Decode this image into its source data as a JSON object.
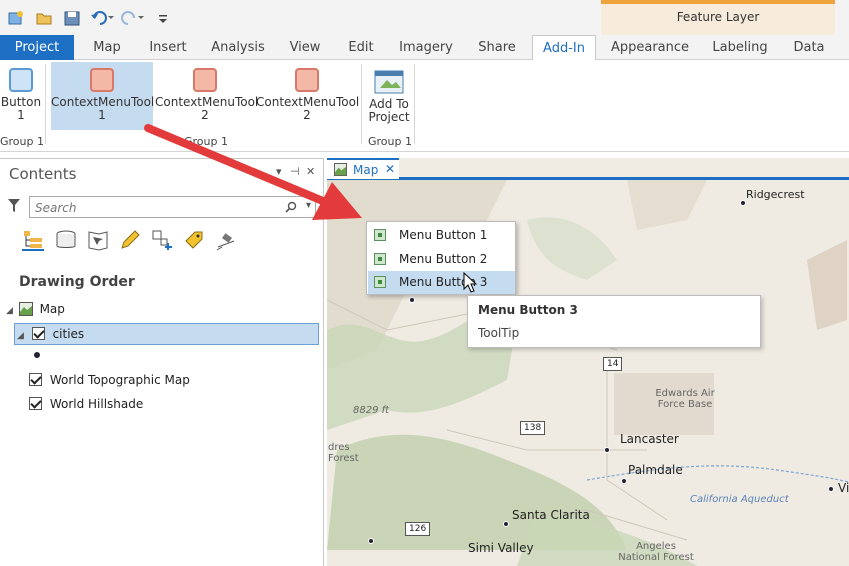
{
  "colors": {
    "accent": "#1d6fc4",
    "context_band": "#f0a33a",
    "selection": "#c5dbef"
  },
  "qat": {
    "icons": [
      "new-project-icon",
      "open-project-icon",
      "save-project-icon",
      "undo-icon",
      "redo-icon",
      "customize-icon"
    ]
  },
  "context_tab": {
    "label": "Feature Layer"
  },
  "tabs": [
    {
      "label": "Project"
    },
    {
      "label": "Map"
    },
    {
      "label": "Insert"
    },
    {
      "label": "Analysis"
    },
    {
      "label": "View"
    },
    {
      "label": "Edit"
    },
    {
      "label": "Imagery"
    },
    {
      "label": "Share"
    },
    {
      "label": "Add-In"
    },
    {
      "label": "Appearance"
    },
    {
      "label": "Labeling"
    },
    {
      "label": "Data"
    }
  ],
  "active_tab": "Add-In",
  "ribbon": {
    "buttons": [
      {
        "line1": "Button",
        "line2": "1"
      },
      {
        "line1": "ContextMenuTool",
        "line2": "1"
      },
      {
        "line1": "ContextMenuTool",
        "line2": "2"
      },
      {
        "line1": "ContextMenuTool",
        "line2": "2"
      },
      {
        "line1": "Add To",
        "line2": "Project"
      }
    ],
    "groups": [
      "Group 1",
      "Group 1",
      "Group 1"
    ]
  },
  "contents": {
    "title": "Contents",
    "search_placeholder": "Search",
    "heading": "Drawing Order",
    "tree": {
      "map": "Map",
      "layer": "cities",
      "basemap1": "World Topographic Map",
      "basemap2": "World Hillshade"
    },
    "tool_icons": [
      "list-by-drawing-order-icon",
      "list-by-source-icon",
      "list-by-selection-icon",
      "list-by-editing-icon",
      "list-by-snapping-icon",
      "list-by-labeling-icon",
      "list-by-perspective-icon"
    ]
  },
  "map": {
    "tab_label": "Map",
    "cities": [
      "Ridgecrest",
      "Lancaster",
      "Palmdale",
      "Santa Clarita",
      "Simi Valley",
      "Vi"
    ],
    "labels": {
      "edwards": "Edwards Air Force Base",
      "angeles": "Angeles National Forest",
      "aqueduct": "California Aqueduct",
      "elevation": "8829 ft",
      "forest_left": "dres Forest"
    },
    "shields": [
      "14",
      "138",
      "126"
    ]
  },
  "context_menu": {
    "items": [
      "Menu Button 1",
      "Menu Button 2",
      "Menu Button 3"
    ],
    "highlighted": "Menu Button 3"
  },
  "tooltip": {
    "title": "Menu Button 3",
    "body": "ToolTip"
  }
}
